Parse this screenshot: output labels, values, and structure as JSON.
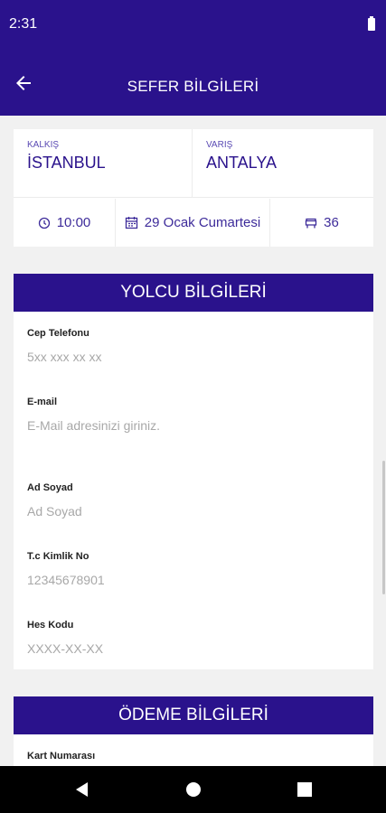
{
  "status_bar": {
    "time": "2:31"
  },
  "header": {
    "title": "SEFER BİLGİLERİ"
  },
  "trip": {
    "from_label": "KALKIŞ",
    "from_city": "İSTANBUL",
    "to_label": "VARIŞ",
    "to_city": "ANTALYA",
    "time": "10:00",
    "date": "29 Ocak Cumartesi",
    "seat": "36"
  },
  "passenger": {
    "title": "YOLCU BİLGİLERİ",
    "fields": [
      {
        "label": "Cep Telefonu",
        "placeholder": "5xx xxx xx xx"
      },
      {
        "label": "E-mail",
        "placeholder": "E-Mail adresinizi giriniz."
      },
      {
        "label": "Ad Soyad",
        "placeholder": "Ad Soyad"
      },
      {
        "label": "T.c Kimlik No",
        "placeholder": "12345678901"
      },
      {
        "label": "Hes Kodu",
        "placeholder": "XXXX-XX-XX"
      }
    ]
  },
  "payment": {
    "title": "ÖDEME BİLGİLERİ",
    "card_number_label": "Kart Numarası"
  },
  "colors": {
    "primary": "#2a128c",
    "accent_text": "#3d2b9a",
    "placeholder": "#a8a8a8"
  }
}
